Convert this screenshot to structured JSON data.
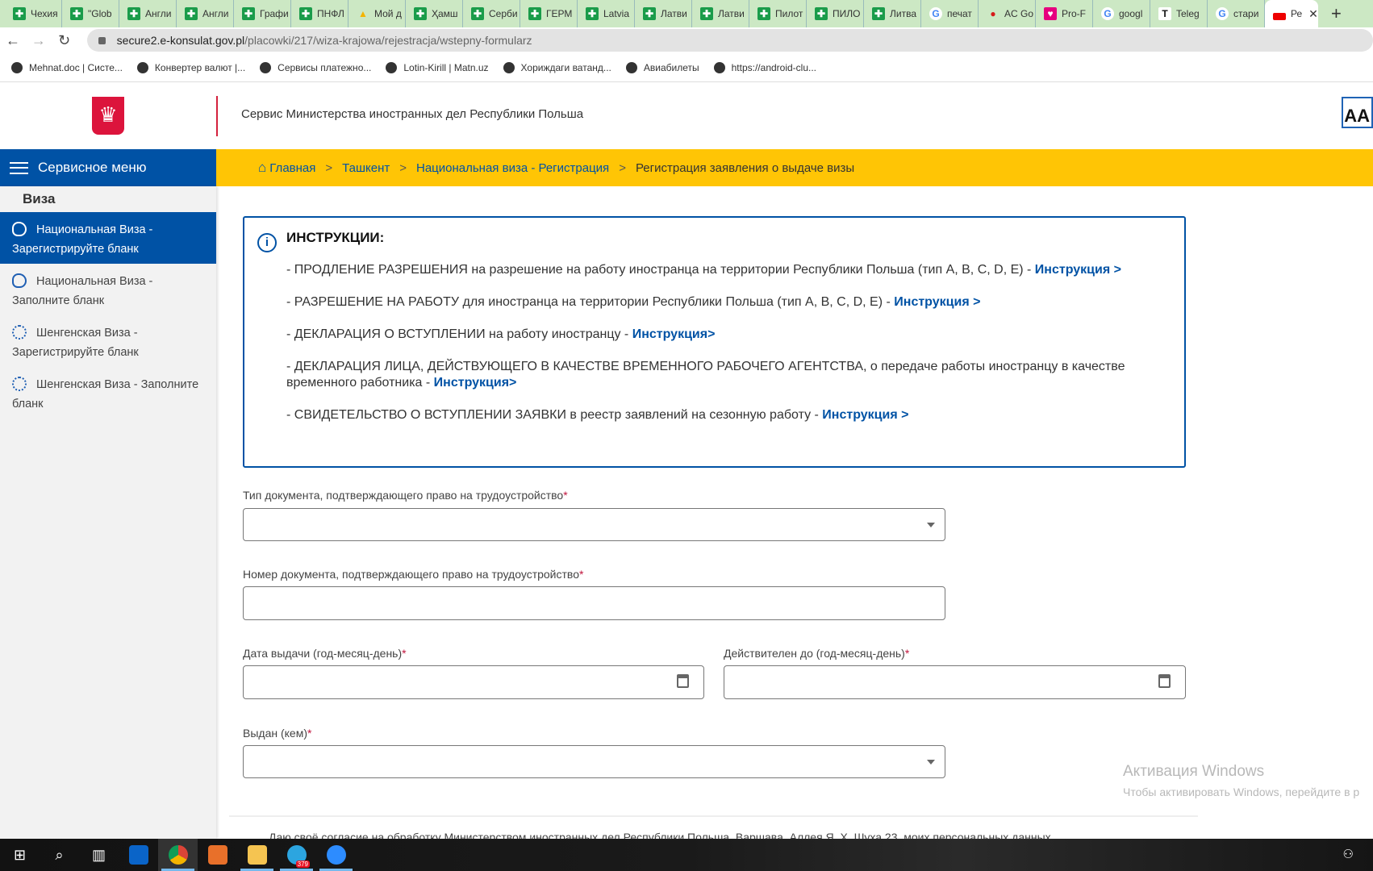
{
  "browser": {
    "tabs": [
      {
        "label": "Чехия",
        "icon": "green-cross-icon",
        "color": "#1a9c4a"
      },
      {
        "label": "\"Glob",
        "icon": "green-cross-icon",
        "color": "#1a9c4a"
      },
      {
        "label": "Англи",
        "icon": "green-cross-icon",
        "color": "#1a9c4a"
      },
      {
        "label": "Англи",
        "icon": "green-cross-icon",
        "color": "#1a9c4a"
      },
      {
        "label": "Графи",
        "icon": "green-cross-icon",
        "color": "#1a9c4a"
      },
      {
        "label": "ПНФЛ",
        "icon": "green-cross-icon",
        "color": "#1a9c4a"
      },
      {
        "label": "Мой д",
        "icon": "google-drive-icon",
        "color": "#f4b400"
      },
      {
        "label": "Ҳамш",
        "icon": "green-cross-icon",
        "color": "#1a9c4a"
      },
      {
        "label": "Серби",
        "icon": "green-cross-icon",
        "color": "#1a9c4a"
      },
      {
        "label": "ГЕРМ",
        "icon": "green-cross-icon",
        "color": "#1a9c4a"
      },
      {
        "label": "Latvia",
        "icon": "green-cross-icon",
        "color": "#1a9c4a"
      },
      {
        "label": "Латви",
        "icon": "green-cross-icon",
        "color": "#1a9c4a"
      },
      {
        "label": "Латви",
        "icon": "green-cross-icon",
        "color": "#1a9c4a"
      },
      {
        "label": "Пилот",
        "icon": "green-cross-icon",
        "color": "#1a9c4a"
      },
      {
        "label": "ПИЛО",
        "icon": "green-cross-icon",
        "color": "#1a9c4a"
      },
      {
        "label": "Литва",
        "icon": "green-cross-icon",
        "color": "#1a9c4a"
      },
      {
        "label": "печат",
        "icon": "google-icon",
        "color": "#4285f4"
      },
      {
        "label": "AC Go",
        "icon": "apple-icon",
        "color": "#d61a1a"
      },
      {
        "label": "Pro-F",
        "icon": "pro-f-icon",
        "color": "#e6007e"
      },
      {
        "label": "googl",
        "icon": "google-icon",
        "color": "#4285f4"
      },
      {
        "label": "Teleg",
        "icon": "t-icon",
        "color": "#111111"
      },
      {
        "label": "стари",
        "icon": "google-icon",
        "color": "#4285f4"
      }
    ],
    "active_tab": {
      "label": "Ре",
      "icon": "poland-flag-icon",
      "color": "#ee0000"
    },
    "url_host": "secure2.e-konsulat.gov.pl",
    "url_path": "/placowki/217/wiza-krajowa/rejestracja/wstepny-formularz",
    "bookmarks": [
      "Mehnat.doc | Систе...",
      "Конвертер валют |...",
      "Сервисы платежно...",
      "Lotin-Kirill | Matn.uz",
      "Хориждаги ватанд...",
      "Авиабилеты",
      "https://android-clu..."
    ]
  },
  "header": {
    "service_title": "Сервис Министерства иностранных дел Республики Польша",
    "font_size_label": "AA"
  },
  "menu": {
    "title": "Сервисное меню",
    "section": "Виза",
    "items": [
      {
        "label": "Национальная Виза - Зарегистрируйте бланк",
        "active": true,
        "icon": "poland-map-icon"
      },
      {
        "label": "Национальная Виза - Заполните бланк",
        "active": false,
        "icon": "poland-map-icon"
      },
      {
        "label": "Шенгенская Виза - Зарегистрируйте бланк",
        "active": false,
        "icon": "eu-stars-icon"
      },
      {
        "label": "Шенгенская Виза - Заполните бланк",
        "active": false,
        "icon": "eu-stars-icon"
      }
    ]
  },
  "breadcrumb": {
    "items": [
      "Главная",
      "Ташкент",
      "Национальная виза - Регистрация"
    ],
    "current": "Регистрация заявления о выдаче визы",
    "separator": ">"
  },
  "instructions": {
    "title": "ИНСТРУКЦИИ:",
    "items": [
      {
        "text": "- ПРОДЛЕНИЕ РАЗРЕШЕНИЯ на разрешение на работу иностранца на территории Республики Польша (тип A, B, C, D, E) - ",
        "link": "Инструкция >"
      },
      {
        "text": "- РАЗРЕШЕНИЕ НА РАБОТУ для иностранца на территории Республики Польша (тип A, B, C, D, E) - ",
        "link": "Инструкция >"
      },
      {
        "text": "- ДЕКЛАРАЦИЯ О ВСТУПЛЕНИИ на работу иностранцу - ",
        "link": "Инструкция>"
      },
      {
        "text": "- ДЕКЛАРАЦИЯ ЛИЦА, ДЕЙСТВУЮЩЕГО В КАЧЕСТВЕ ВРЕМЕННОГО РАБОЧЕГО АГЕНТСТВА, о передаче работы иностранцу в качестве временного работника - ",
        "link": "Инструкция>"
      },
      {
        "text": "- СВИДЕТЕЛЬСТВО О ВСТУПЛЕНИИ ЗАЯВКИ в реестр заявлений на сезонную работу - ",
        "link": "Инструкция >"
      }
    ]
  },
  "form": {
    "required_mark": "*",
    "doc_type": {
      "label": "Тип документа, подтверждающего право на трудоустройство",
      "value": ""
    },
    "doc_number": {
      "label": "Номер документа, подтверждающего право на трудоустройство",
      "value": ""
    },
    "issue_date": {
      "label": "Дата выдачи (год-месяц-день)",
      "value": ""
    },
    "valid_until": {
      "label": "Действителен до (год-месяц-день)",
      "value": ""
    },
    "issued_by": {
      "label": "Выдан (кем)",
      "value": ""
    },
    "consent_text": "Даю своё согласие на обработку Министерством иностранных дел Республики Польша, Варшава, Аллея Я. Х. Шуха 23, моих персональных данных"
  },
  "windows": {
    "activation_title": "Активация Windows",
    "activation_text": "Чтобы активировать Windows, перейдите в р",
    "telegram_badge": "379"
  }
}
